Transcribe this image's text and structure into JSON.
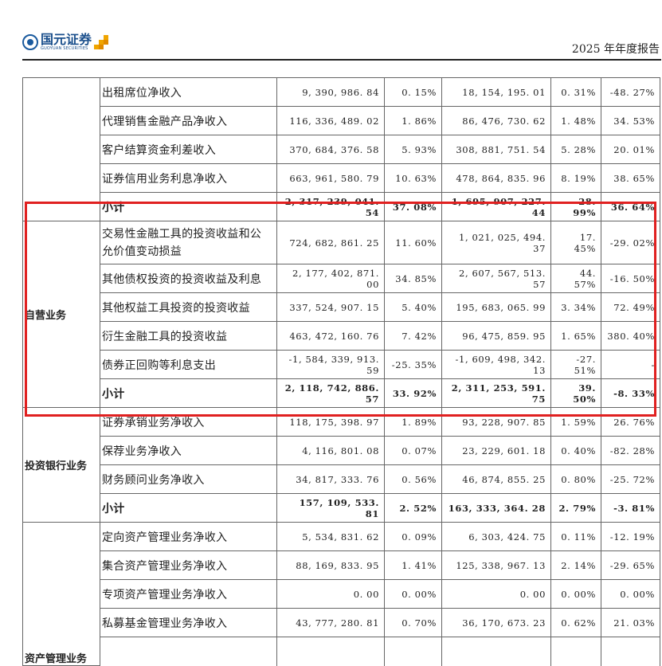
{
  "header": {
    "logo_cn": "国元证券",
    "logo_en": "GUOYUAN SECURITIES",
    "doc_title": "2025 年年度报告"
  },
  "table": {
    "groups": [
      {
        "category": "",
        "rows": [
          {
            "item": "出租席位净收入",
            "v1": "9, 390, 986. 84",
            "p1": "0. 15%",
            "v2": "18, 154, 195. 01",
            "p2": "0. 31%",
            "chg": "-48. 27%"
          },
          {
            "item": "代理销售金融产品净收入",
            "v1": "116, 336, 489. 02",
            "p1": "1. 86%",
            "v2": "86, 476, 730. 62",
            "p2": "1. 48%",
            "chg": "34. 53%"
          },
          {
            "item": "客户结算资金利差收入",
            "v1": "370, 684, 376. 58",
            "p1": "5. 93%",
            "v2": "308, 881, 751. 54",
            "p2": "5. 28%",
            "chg": "20. 01%"
          },
          {
            "item": "证券信用业务利息净收入",
            "v1": "663, 961, 580. 79",
            "p1": "10. 63%",
            "v2": "478, 864, 835. 96",
            "p2": "8. 19%",
            "chg": "38. 65%"
          },
          {
            "item": "小计",
            "v1": "2, 317, 239, 041. 54",
            "p1": "37. 08%",
            "v2": "1, 695, 907, 227. 44",
            "p2": "28. 99%",
            "chg": "36. 64%",
            "subtotal": true
          }
        ]
      },
      {
        "category": "自营业务",
        "rows": [
          {
            "item": "交易性金融工具的投资收益和公允价值变动损益",
            "v1": "724, 682, 861. 25",
            "p1": "11. 60%",
            "v2": "1, 021, 025, 494. 37",
            "p2": "17. 45%",
            "chg": "-29. 02%"
          },
          {
            "item": "其他债权投资的投资收益及利息",
            "v1": "2, 177, 402, 871. 00",
            "p1": "34. 85%",
            "v2": "2, 607, 567, 513. 57",
            "p2": "44. 57%",
            "chg": "-16. 50%"
          },
          {
            "item": "其他权益工具投资的投资收益",
            "v1": "337, 524, 907. 15",
            "p1": "5. 40%",
            "v2": "195, 683, 065. 99",
            "p2": "3. 34%",
            "chg": "72. 49%"
          },
          {
            "item": "衍生金融工具的投资收益",
            "v1": "463, 472, 160. 76",
            "p1": "7. 42%",
            "v2": "96, 475, 859. 95",
            "p2": "1. 65%",
            "chg": "380. 40%"
          },
          {
            "item": "债券正回购等利息支出",
            "v1": "-1, 584, 339, 913. 59",
            "p1": "-25. 35%",
            "v2": "-1, 609, 498, 342. 13",
            "p2": "-27. 51%",
            "chg": "-"
          },
          {
            "item": "小计",
            "v1": "2, 118, 742, 886. 57",
            "p1": "33. 92%",
            "v2": "2, 311, 253, 591. 75",
            "p2": "39. 50%",
            "chg": "-8. 33%",
            "subtotal": true
          }
        ]
      },
      {
        "category": "投资银行业务",
        "rows": [
          {
            "item": "证券承销业务净收入",
            "v1": "118, 175, 398. 97",
            "p1": "1. 89%",
            "v2": "93, 228, 907. 85",
            "p2": "1. 59%",
            "chg": "26. 76%"
          },
          {
            "item": "保荐业务净收入",
            "v1": "4, 116, 801. 08",
            "p1": "0. 07%",
            "v2": "23, 229, 601. 18",
            "p2": "0. 40%",
            "chg": "-82. 28%"
          },
          {
            "item": "财务顾问业务净收入",
            "v1": "34, 817, 333. 76",
            "p1": "0. 56%",
            "v2": "46, 874, 855. 25",
            "p2": "0. 80%",
            "chg": "-25. 72%"
          },
          {
            "item": "小计",
            "v1": "157, 109, 533. 81",
            "p1": "2. 52%",
            "v2": "163, 333, 364. 28",
            "p2": "2. 79%",
            "chg": "-3. 81%",
            "subtotal": true
          }
        ]
      },
      {
        "category": "资产管理业务",
        "rows": [
          {
            "item": "定向资产管理业务净收入",
            "v1": "5, 534, 831. 62",
            "p1": "0. 09%",
            "v2": "6, 303, 424. 75",
            "p2": "0. 11%",
            "chg": "-12. 19%"
          },
          {
            "item": "集合资产管理业务净收入",
            "v1": "88, 169, 833. 95",
            "p1": "1. 41%",
            "v2": "125, 338, 967. 13",
            "p2": "2. 14%",
            "chg": "-29. 65%"
          },
          {
            "item": "专项资产管理业务净收入",
            "v1": "0. 00",
            "p1": "0. 00%",
            "v2": "0. 00",
            "p2": "0. 00%",
            "chg": "0. 00%"
          },
          {
            "item": "私募基金管理业务净收入",
            "v1": "43, 777, 280. 81",
            "p1": "0. 70%",
            "v2": "36, 170, 673. 23",
            "p2": "0. 62%",
            "chg": "21. 03%"
          },
          {
            "item": "",
            "v1": "",
            "p1": "",
            "v2": "",
            "p2": "",
            "chg": ""
          }
        ]
      }
    ]
  }
}
